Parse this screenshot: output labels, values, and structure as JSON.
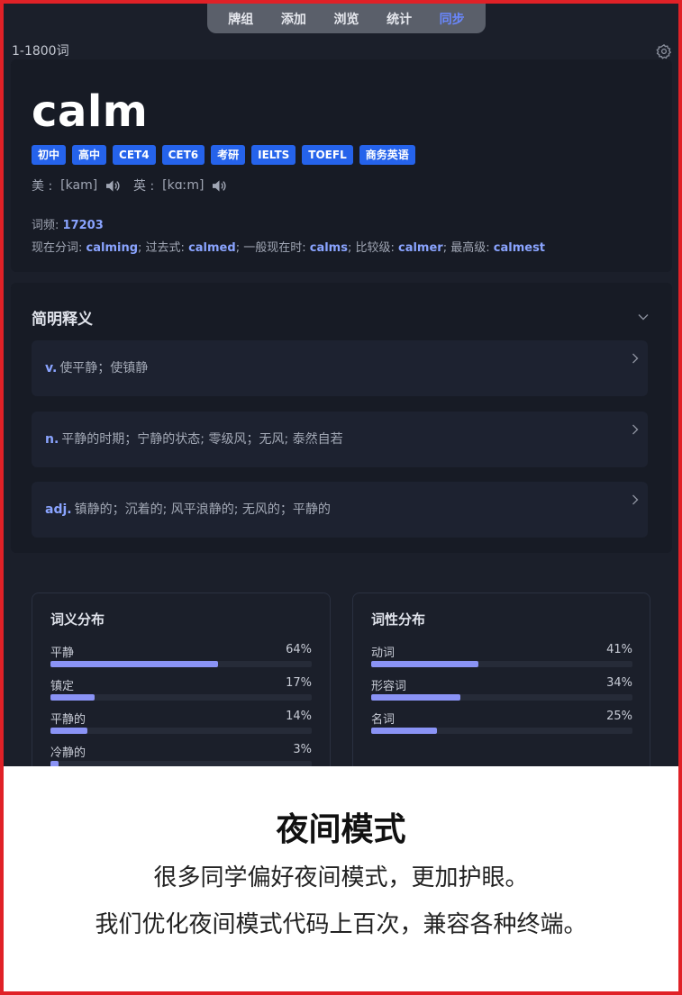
{
  "nav": {
    "items": [
      {
        "label": "牌组",
        "active": false
      },
      {
        "label": "添加",
        "active": false
      },
      {
        "label": "浏览",
        "active": false
      },
      {
        "label": "统计",
        "active": false
      },
      {
        "label": "同步",
        "active": true
      }
    ]
  },
  "deck_name": "1-1800词",
  "word": {
    "headword": "calm",
    "tags": [
      "初中",
      "高中",
      "CET4",
      "CET6",
      "考研",
      "IELTS",
      "TOEFL",
      "商务英语"
    ],
    "us_label": "美 :",
    "us_phonetic": "[kam]",
    "uk_label": "英 :",
    "uk_phonetic": "[kɑːm]",
    "freq_label": "词频:",
    "freq_value": "17203",
    "forms": [
      {
        "label": "现在分词:",
        "value": "calming"
      },
      {
        "label": "过去式:",
        "value": "calmed"
      },
      {
        "label": "一般现在时:",
        "value": "calms"
      },
      {
        "label": "比较级:",
        "value": "calmer"
      },
      {
        "label": "最高级:",
        "value": "calmest"
      }
    ]
  },
  "definitions": {
    "title": "简明释义",
    "items": [
      {
        "pos": "v.",
        "text": "使平静；使镇静"
      },
      {
        "pos": "n.",
        "text": "平静的时期；宁静的状态; 零级风；无风; 泰然自若"
      },
      {
        "pos": "adj.",
        "text": "镇静的；沉着的; 风平浪静的; 无风的；平静的"
      }
    ]
  },
  "sense_stats": {
    "title": "词义分布",
    "rows": [
      {
        "label": "平静",
        "pct_text": "64%",
        "fraction": 0.64
      },
      {
        "label": "镇定",
        "pct_text": "17%",
        "fraction": 0.17
      },
      {
        "label": "平静的",
        "pct_text": "14%",
        "fraction": 0.14
      },
      {
        "label": "冷静的",
        "pct_text": "3%",
        "fraction": 0.03
      }
    ]
  },
  "pos_stats": {
    "title": "词性分布",
    "rows": [
      {
        "label": "动词",
        "pct_text": "41%",
        "fraction": 0.41
      },
      {
        "label": "形容词",
        "pct_text": "34%",
        "fraction": 0.34
      },
      {
        "label": "名词",
        "pct_text": "25%",
        "fraction": 0.25
      }
    ]
  },
  "promo": {
    "title": "夜间模式",
    "line1": "很多同学偏好夜间模式，更加护眼。",
    "line2": "我们优化夜间模式代码上百次，兼容各种终端。"
  },
  "colors": {
    "accent": "#8aa4ff",
    "tag_bg": "#2563eb",
    "bar_fill": "#8a93f5",
    "background": "#1b1f2a",
    "border": "#e02127"
  },
  "icons": {
    "settings": "gear-icon",
    "pronounce": "speaker-icon",
    "collapse": "chevron-down-icon",
    "expand": "chevron-right-icon"
  }
}
